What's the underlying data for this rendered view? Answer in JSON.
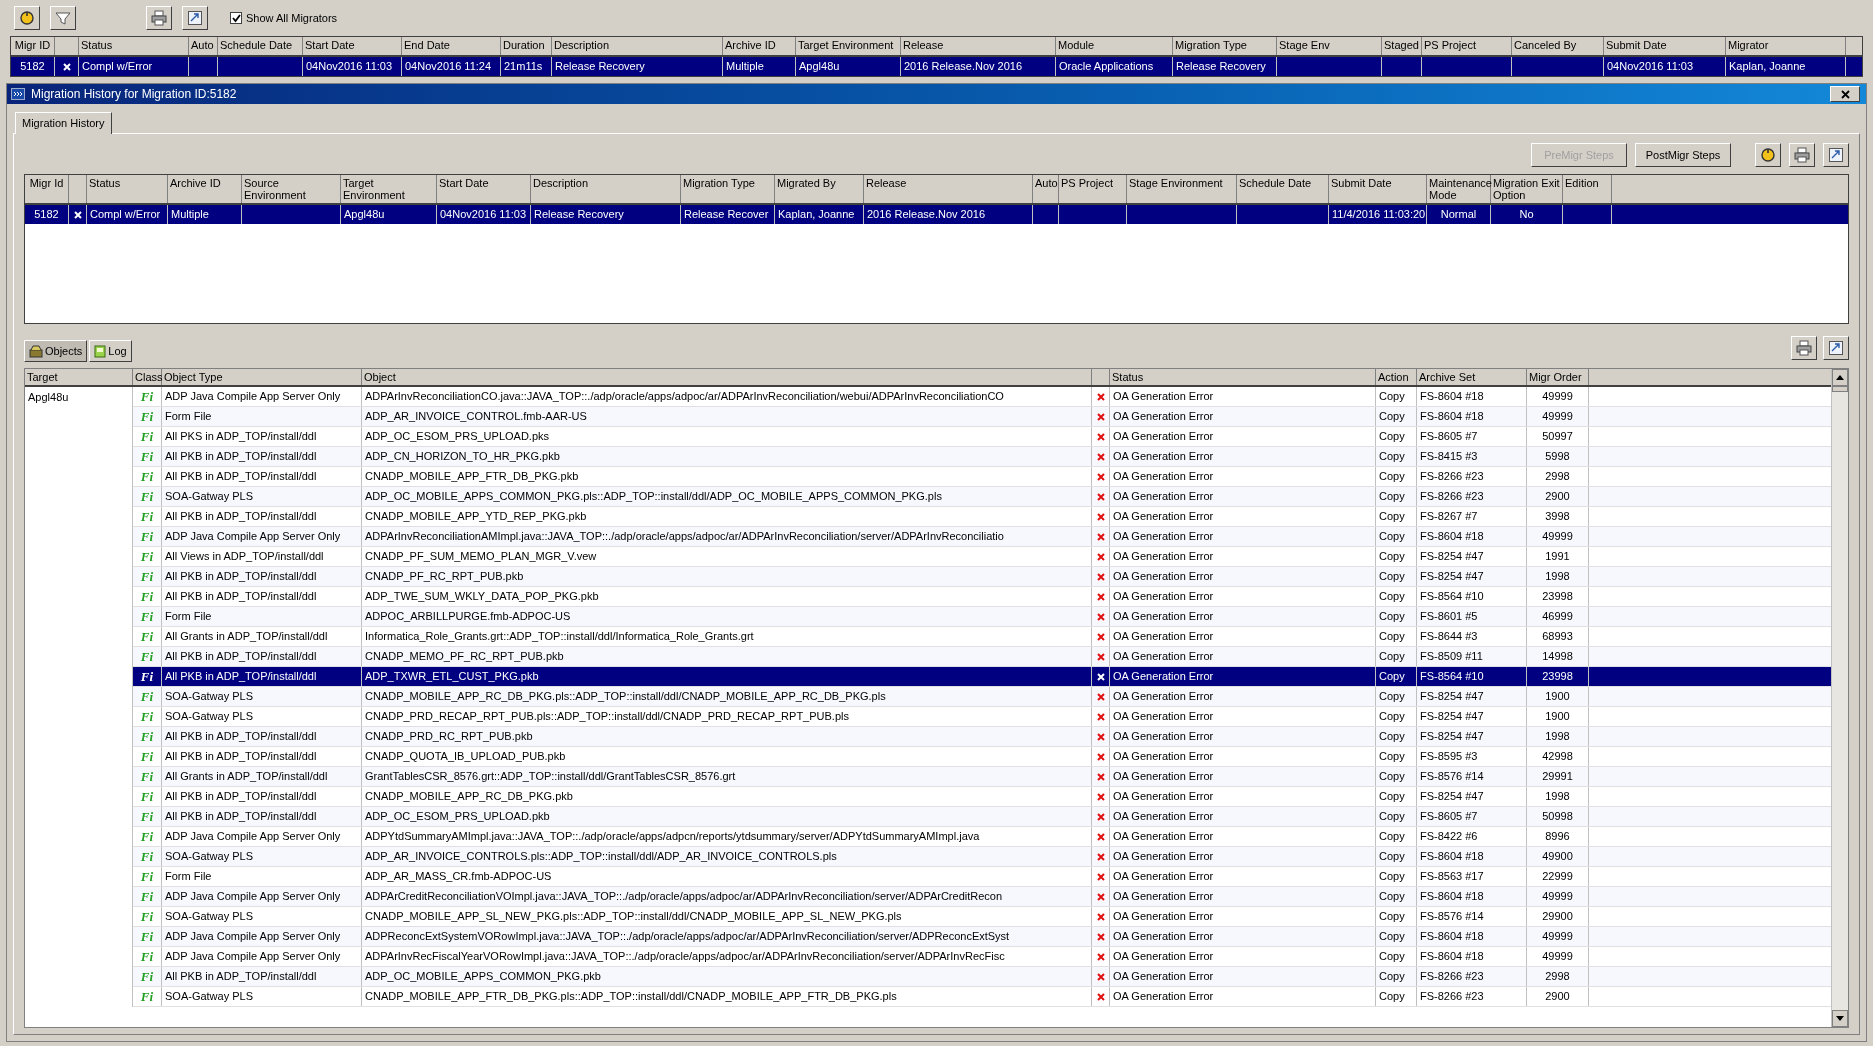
{
  "toolbar": {
    "show_all_migrators": {
      "label": "Show All Migrators",
      "checked": true
    }
  },
  "migrations": {
    "columns": [
      "Migr ID",
      "Status",
      "Auto",
      "Schedule Date",
      "Start Date",
      "End Date",
      "Duration",
      "Description",
      "Archive ID",
      "Target Environment",
      "Release",
      "Module",
      "Migration Type",
      "Stage Env",
      "Staged",
      "PS Project",
      "Canceled By",
      "Submit Date",
      "Migrator"
    ],
    "rows": [
      {
        "selected": true,
        "cells": [
          "5182",
          "Compl w/Error",
          null,
          null,
          "04Nov2016 11:03",
          "04Nov2016 11:24",
          "21m11s",
          "Release Recovery",
          "Multiple",
          "Apgl48u",
          "2016 Release.Nov 2016",
          "Oracle Applications",
          "Release Recovery",
          null,
          null,
          null,
          null,
          "04Nov2016 11:03",
          "Kaplan, Joanne"
        ]
      }
    ]
  },
  "dialog": {
    "title": "Migration History for Migration ID:5182",
    "tabs": [
      {
        "label": "Migration History",
        "selected": true
      }
    ],
    "buttons": [
      {
        "label": "PreMigr Steps",
        "disabled": true
      },
      {
        "label": "PostMigr Steps",
        "disabled": false
      }
    ],
    "history": {
      "columns": [
        "Migr Id",
        "Status",
        "Archive ID",
        "Source Environment",
        "Target Environment",
        "Start Date",
        "Description",
        "Migration Type",
        "Migrated By",
        "Release",
        "Auto",
        "PS Project",
        "Stage Environment",
        "Schedule Date",
        "Submit Date",
        "Maintenance Mode",
        "Migration Exit Option",
        "Edition"
      ],
      "rows": [
        {
          "selected": true,
          "cells": [
            "5182",
            "Compl w/Error",
            "Multiple",
            null,
            "Apgl48u",
            "04Nov2016 11:03",
            "Release Recovery",
            "Release Recover",
            "Kaplan, Joanne",
            "2016 Release.Nov 2016",
            null,
            null,
            null,
            null,
            "11/4/2016 11:03:20",
            "Normal",
            "No",
            null
          ]
        }
      ]
    },
    "object_tabs": [
      {
        "label": "Objects",
        "selected": true,
        "kind": "objects"
      },
      {
        "label": "Log",
        "selected": false,
        "kind": "log"
      }
    ],
    "objects": {
      "columns": [
        "Target",
        "Class",
        "Object Type",
        "Object",
        "Status",
        "Action",
        "Archive Set",
        "Migr Order"
      ],
      "target": "Apgl48u",
      "rows": [
        {
          "class": "Fi",
          "object_type": "ADP Java Compile App Server Only",
          "object": "ADPArInvReconciliationCO.java::JAVA_TOP::./adp/oracle/apps/adpoc/ar/ADPArInvReconciliation/webui/ADPArInvReconciliationCO",
          "status": "OA Generation Error",
          "action": "Copy",
          "archive_set": "FS-8604 #18",
          "migr_order": "49999",
          "selected": false
        },
        {
          "class": "Fi",
          "object_type": "Form File",
          "object": "ADP_AR_INVOICE_CONTROL.fmb-AAR-US",
          "status": "OA Generation Error",
          "action": "Copy",
          "archive_set": "FS-8604 #18",
          "migr_order": "49999",
          "selected": false
        },
        {
          "class": "Fi",
          "object_type": "All PKS in ADP_TOP/install/ddl",
          "object": "ADP_OC_ESOM_PRS_UPLOAD.pks",
          "status": "OA Generation Error",
          "action": "Copy",
          "archive_set": "FS-8605 #7",
          "migr_order": "50997",
          "selected": false
        },
        {
          "class": "Fi",
          "object_type": "All PKB in ADP_TOP/install/ddl",
          "object": "ADP_CN_HORIZON_TO_HR_PKG.pkb",
          "status": "OA Generation Error",
          "action": "Copy",
          "archive_set": "FS-8415 #3",
          "migr_order": "5998",
          "selected": false
        },
        {
          "class": "Fi",
          "object_type": "All PKB in ADP_TOP/install/ddl",
          "object": "CNADP_MOBILE_APP_FTR_DB_PKG.pkb",
          "status": "OA Generation Error",
          "action": "Copy",
          "archive_set": "FS-8266 #23",
          "migr_order": "2998",
          "selected": false
        },
        {
          "class": "Fi",
          "object_type": "SOA-Gatway PLS",
          "object": "ADP_OC_MOBILE_APPS_COMMON_PKG.pls::ADP_TOP::install/ddl/ADP_OC_MOBILE_APPS_COMMON_PKG.pls",
          "status": "OA Generation Error",
          "action": "Copy",
          "archive_set": "FS-8266 #23",
          "migr_order": "2900",
          "selected": false
        },
        {
          "class": "Fi",
          "object_type": "All PKB in ADP_TOP/install/ddl",
          "object": "CNADP_MOBILE_APP_YTD_REP_PKG.pkb",
          "status": "OA Generation Error",
          "action": "Copy",
          "archive_set": "FS-8267 #7",
          "migr_order": "3998",
          "selected": false
        },
        {
          "class": "Fi",
          "object_type": "ADP Java Compile App Server Only",
          "object": "ADPArInvReconciliationAMImpl.java::JAVA_TOP::./adp/oracle/apps/adpoc/ar/ADPArInvReconciliation/server/ADPArInvReconciliatio",
          "status": "OA Generation Error",
          "action": "Copy",
          "archive_set": "FS-8604 #18",
          "migr_order": "49999",
          "selected": false
        },
        {
          "class": "Fi",
          "object_type": "All Views in ADP_TOP/install/ddl",
          "object": "CNADP_PF_SUM_MEMO_PLAN_MGR_V.vew",
          "status": "OA Generation Error",
          "action": "Copy",
          "archive_set": "FS-8254 #47",
          "migr_order": "1991",
          "selected": false
        },
        {
          "class": "Fi",
          "object_type": "All PKB in ADP_TOP/install/ddl",
          "object": "CNADP_PF_RC_RPT_PUB.pkb",
          "status": "OA Generation Error",
          "action": "Copy",
          "archive_set": "FS-8254 #47",
          "migr_order": "1998",
          "selected": false
        },
        {
          "class": "Fi",
          "object_type": "All PKB in ADP_TOP/install/ddl",
          "object": "ADP_TWE_SUM_WKLY_DATA_POP_PKG.pkb",
          "status": "OA Generation Error",
          "action": "Copy",
          "archive_set": "FS-8564 #10",
          "migr_order": "23998",
          "selected": false
        },
        {
          "class": "Fi",
          "object_type": "Form File",
          "object": "ADPOC_ARBILLPURGE.fmb-ADPOC-US",
          "status": "OA Generation Error",
          "action": "Copy",
          "archive_set": "FS-8601 #5",
          "migr_order": "46999",
          "selected": false
        },
        {
          "class": "Fi",
          "object_type": "All Grants in ADP_TOP/install/ddl",
          "object": "Informatica_Role_Grants.grt::ADP_TOP::install/ddl/Informatica_Role_Grants.grt",
          "status": "OA Generation Error",
          "action": "Copy",
          "archive_set": "FS-8644 #3",
          "migr_order": "68993",
          "selected": false
        },
        {
          "class": "Fi",
          "object_type": "All PKB in ADP_TOP/install/ddl",
          "object": "CNADP_MEMO_PF_RC_RPT_PUB.pkb",
          "status": "OA Generation Error",
          "action": "Copy",
          "archive_set": "FS-8509 #11",
          "migr_order": "14998",
          "selected": false
        },
        {
          "class": "Fi",
          "object_type": "All PKB in ADP_TOP/install/ddl",
          "object": "ADP_TXWR_ETL_CUST_PKG.pkb",
          "status": "OA Generation Error",
          "action": "Copy",
          "archive_set": "FS-8564 #10",
          "migr_order": "23998",
          "selected": true
        },
        {
          "class": "Fi",
          "object_type": "SOA-Gatway PLS",
          "object": "CNADP_MOBILE_APP_RC_DB_PKG.pls::ADP_TOP::install/ddl/CNADP_MOBILE_APP_RC_DB_PKG.pls",
          "status": "OA Generation Error",
          "action": "Copy",
          "archive_set": "FS-8254 #47",
          "migr_order": "1900",
          "selected": false
        },
        {
          "class": "Fi",
          "object_type": "SOA-Gatway PLS",
          "object": "CNADP_PRD_RECAP_RPT_PUB.pls::ADP_TOP::install/ddl/CNADP_PRD_RECAP_RPT_PUB.pls",
          "status": "OA Generation Error",
          "action": "Copy",
          "archive_set": "FS-8254 #47",
          "migr_order": "1900",
          "selected": false
        },
        {
          "class": "Fi",
          "object_type": "All PKB in ADP_TOP/install/ddl",
          "object": "CNADP_PRD_RC_RPT_PUB.pkb",
          "status": "OA Generation Error",
          "action": "Copy",
          "archive_set": "FS-8254 #47",
          "migr_order": "1998",
          "selected": false
        },
        {
          "class": "Fi",
          "object_type": "All PKB in ADP_TOP/install/ddl",
          "object": "CNADP_QUOTA_IB_UPLOAD_PUB.pkb",
          "status": "OA Generation Error",
          "action": "Copy",
          "archive_set": "FS-8595 #3",
          "migr_order": "42998",
          "selected": false
        },
        {
          "class": "Fi",
          "object_type": "All Grants in ADP_TOP/install/ddl",
          "object": "GrantTablesCSR_8576.grt::ADP_TOP::install/ddl/GrantTablesCSR_8576.grt",
          "status": "OA Generation Error",
          "action": "Copy",
          "archive_set": "FS-8576 #14",
          "migr_order": "29991",
          "selected": false
        },
        {
          "class": "Fi",
          "object_type": "All PKB in ADP_TOP/install/ddl",
          "object": "CNADP_MOBILE_APP_RC_DB_PKG.pkb",
          "status": "OA Generation Error",
          "action": "Copy",
          "archive_set": "FS-8254 #47",
          "migr_order": "1998",
          "selected": false
        },
        {
          "class": "Fi",
          "object_type": "All PKB in ADP_TOP/install/ddl",
          "object": "ADP_OC_ESOM_PRS_UPLOAD.pkb",
          "status": "OA Generation Error",
          "action": "Copy",
          "archive_set": "FS-8605 #7",
          "migr_order": "50998",
          "selected": false
        },
        {
          "class": "Fi",
          "object_type": "ADP Java Compile App Server Only",
          "object": "ADPYtdSummaryAMImpl.java::JAVA_TOP::./adp/oracle/apps/adpcn/reports/ytdsummary/server/ADPYtdSummaryAMImpl.java",
          "status": "OA Generation Error",
          "action": "Copy",
          "archive_set": "FS-8422 #6",
          "migr_order": "8996",
          "selected": false
        },
        {
          "class": "Fi",
          "object_type": "SOA-Gatway PLS",
          "object": "ADP_AR_INVOICE_CONTROLS.pls::ADP_TOP::install/ddl/ADP_AR_INVOICE_CONTROLS.pls",
          "status": "OA Generation Error",
          "action": "Copy",
          "archive_set": "FS-8604 #18",
          "migr_order": "49900",
          "selected": false
        },
        {
          "class": "Fi",
          "object_type": "Form File",
          "object": "ADP_AR_MASS_CR.fmb-ADPOC-US",
          "status": "OA Generation Error",
          "action": "Copy",
          "archive_set": "FS-8563 #17",
          "migr_order": "22999",
          "selected": false
        },
        {
          "class": "Fi",
          "object_type": "ADP Java Compile App Server Only",
          "object": "ADPArCreditReconciliationVOImpl.java::JAVA_TOP::./adp/oracle/apps/adpoc/ar/ADPArInvReconciliation/server/ADPArCreditRecon",
          "status": "OA Generation Error",
          "action": "Copy",
          "archive_set": "FS-8604 #18",
          "migr_order": "49999",
          "selected": false
        },
        {
          "class": "Fi",
          "object_type": "SOA-Gatway PLS",
          "object": "CNADP_MOBILE_APP_SL_NEW_PKG.pls::ADP_TOP::install/ddl/CNADP_MOBILE_APP_SL_NEW_PKG.pls",
          "status": "OA Generation Error",
          "action": "Copy",
          "archive_set": "FS-8576 #14",
          "migr_order": "29900",
          "selected": false
        },
        {
          "class": "Fi",
          "object_type": "ADP Java Compile App Server Only",
          "object": "ADPReconcExtSystemVORowImpl.java::JAVA_TOP::./adp/oracle/apps/adpoc/ar/ADPArInvReconciliation/server/ADPReconcExtSyst",
          "status": "OA Generation Error",
          "action": "Copy",
          "archive_set": "FS-8604 #18",
          "migr_order": "49999",
          "selected": false
        },
        {
          "class": "Fi",
          "object_type": "ADP Java Compile App Server Only",
          "object": "ADPArInvRecFiscalYearVORowImpl.java::JAVA_TOP::./adp/oracle/apps/adpoc/ar/ADPArInvReconciliation/server/ADPArInvRecFisc",
          "status": "OA Generation Error",
          "action": "Copy",
          "archive_set": "FS-8604 #18",
          "migr_order": "49999",
          "selected": false
        },
        {
          "class": "Fi",
          "object_type": "All PKB in ADP_TOP/install/ddl",
          "object": "ADP_OC_MOBILE_APPS_COMMON_PKG.pkb",
          "status": "OA Generation Error",
          "action": "Copy",
          "archive_set": "FS-8266 #23",
          "migr_order": "2998",
          "selected": false
        },
        {
          "class": "Fi",
          "object_type": "SOA-Gatway PLS",
          "object": "CNADP_MOBILE_APP_FTR_DB_PKG.pls::ADP_TOP::install/ddl/CNADP_MOBILE_APP_FTR_DB_PKG.pls",
          "status": "OA Generation Error",
          "action": "Copy",
          "archive_set": "FS-8266 #23",
          "migr_order": "2900",
          "selected": false
        }
      ]
    }
  }
}
